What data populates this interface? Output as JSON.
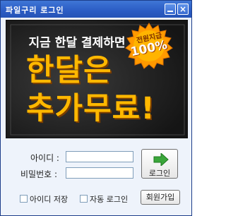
{
  "window": {
    "title": "파일구리 로그인",
    "close_glyph": "×"
  },
  "banner": {
    "line1": "지금 한달 결제하면",
    "line2": "한달은",
    "line3": "추가무료!",
    "badge_line1": "전원지급",
    "badge_line2": "100%",
    "text_color": "#ffb800"
  },
  "form": {
    "id_label": "아이디 :",
    "id_value": "",
    "password_label": "비밀번호 :",
    "password_value": ""
  },
  "login_button": {
    "label": "로그인",
    "icon": "green-arrow-icon"
  },
  "options": {
    "save_id": {
      "label": "아이디 저장",
      "checked": false
    },
    "auto_login": {
      "label": "자동 로그인",
      "checked": false
    }
  },
  "signup_button": {
    "label": "회원가입"
  },
  "colors": {
    "titlebar": "#2b5cc4",
    "accent": "#ffb800",
    "arrow": "#3aa63a"
  }
}
